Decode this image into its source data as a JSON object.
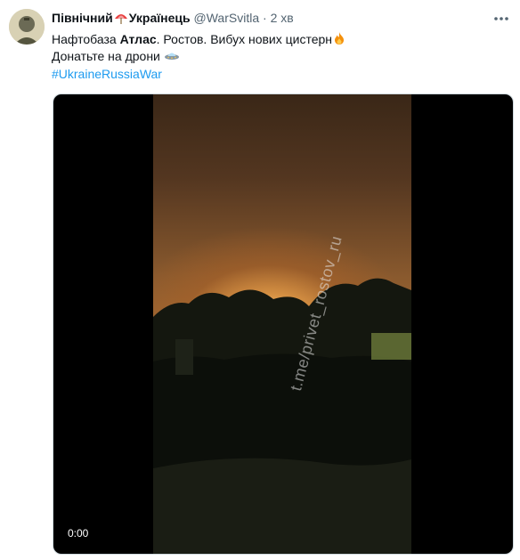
{
  "author": {
    "name_part1": "Північний",
    "name_part2": "Українець",
    "handle": "@WarSvitla",
    "separator": "·",
    "time": "2 хв"
  },
  "tweet": {
    "line1_a": "Нафтобаза ",
    "line1_bold": "Атлас",
    "line1_b": ". Ростов.  Вибух нових цистерн",
    "line2": "Донатьте на дрони ",
    "hashtag": "#UkraineRussiaWar"
  },
  "video": {
    "timestamp": "0:00",
    "watermark": "t.me/privet_rostov_ru"
  },
  "icons": {
    "avatar": "avatar-image",
    "flag": "umbrella-flag-icon",
    "fire": "fire-icon",
    "drone": "ufo-icon",
    "more": "more-icon"
  },
  "colors": {
    "link": "#1d9bf0",
    "secondary_text": "#536471"
  }
}
